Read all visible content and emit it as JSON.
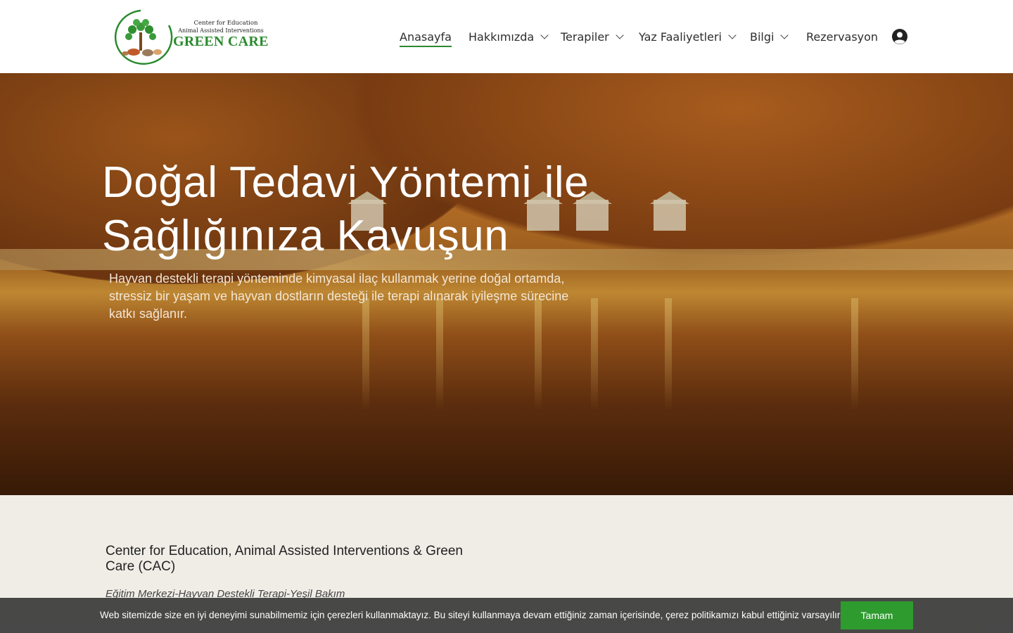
{
  "brand": {
    "line1": "Center for Education",
    "line2": "Animal Assisted Interventions",
    "line3": "GREEN CARE",
    "icon": "tree-logo-icon",
    "color": "#2a8a2e"
  },
  "nav": {
    "items": [
      {
        "label": "Anasayfa",
        "active": true,
        "dropdown": false
      },
      {
        "label": "Hakkımızda",
        "active": false,
        "dropdown": true
      },
      {
        "label": "Terapiler",
        "active": false,
        "dropdown": true
      },
      {
        "label": "Yaz Faaliyetleri",
        "active": false,
        "dropdown": true
      },
      {
        "label": "Bilgi",
        "active": false,
        "dropdown": true
      },
      {
        "label": "Rezervasyon",
        "active": false,
        "dropdown": false
      }
    ],
    "account_icon": "user-circle-icon"
  },
  "hero": {
    "title_line1": "Doğal Tedavi Yöntemi ile",
    "title_line2": "Sağlığınıza Kavuşun",
    "subtitle": "Hayvan destekli terapi yönteminde kimyasal ilaç kullanmak yerine doğal ortamda, stressiz bir yaşam ve hayvan dostların desteği ile terapi alınarak iyileşme sürecine katkı sağlanır."
  },
  "content": {
    "title": "Center for Education, Animal Assisted Interventions & Green Care (CAC)",
    "italic": "Eğitim Merkezi-Hayvan Destekli Terapi-Yeşil Bakım"
  },
  "cookie": {
    "text": "Web sitemizde size en iyi deneyimi sunabilmemiz için çerezleri kullanmaktayız. Bu siteyi kullanmaya devam ettiğiniz zaman içerisinde, çerez politikamızı kabul ettiğiniz varsayılır.",
    "button": "Tamam",
    "button_color": "#2e9b2e"
  }
}
